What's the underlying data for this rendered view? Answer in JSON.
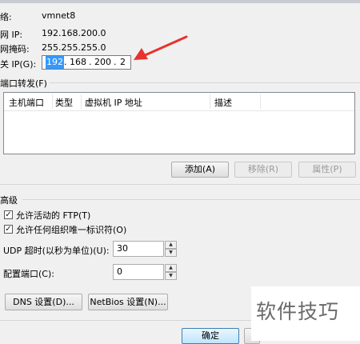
{
  "network": {
    "name_label": "络:",
    "name_value": "vmnet8",
    "subnet_ip_label": "网 IP:",
    "subnet_ip_value": "192.168.200.0",
    "subnet_mask_label": "网掩码:",
    "subnet_mask_value": "255.255.255.0",
    "gateway_label": "关 IP(G):",
    "gateway_octets": [
      "192",
      "168",
      "200",
      "2"
    ]
  },
  "port_forwarding": {
    "section_label": "端口转发(F)",
    "columns": [
      "主机端口",
      "类型",
      "虚拟机 IP 地址",
      "描述"
    ],
    "rows": [],
    "add_button": "添加(A)",
    "remove_button": "移除(R)",
    "properties_button": "属性(P)"
  },
  "advanced": {
    "section_label": "高级",
    "allow_active_ftp_label": "允许活动的 FTP(T)",
    "allow_active_ftp_checked": true,
    "allow_any_oui_label": "允许任何组织唯一标识符(O)",
    "allow_any_oui_checked": true,
    "udp_timeout_label": "UDP 超时(以秒为单位)(U):",
    "udp_timeout_value": "30",
    "config_port_label": "配置端口(C):",
    "config_port_value": "0",
    "dns_button": "DNS 设置(D)...",
    "netbios_button": "NetBios 设置(N)..."
  },
  "footer": {
    "ok_button": "确定"
  },
  "watermark": "软件技巧",
  "colors": {
    "selection": "#3399ff",
    "arrow": "#e8322e",
    "dialog_bg": "#f0f0f0"
  }
}
